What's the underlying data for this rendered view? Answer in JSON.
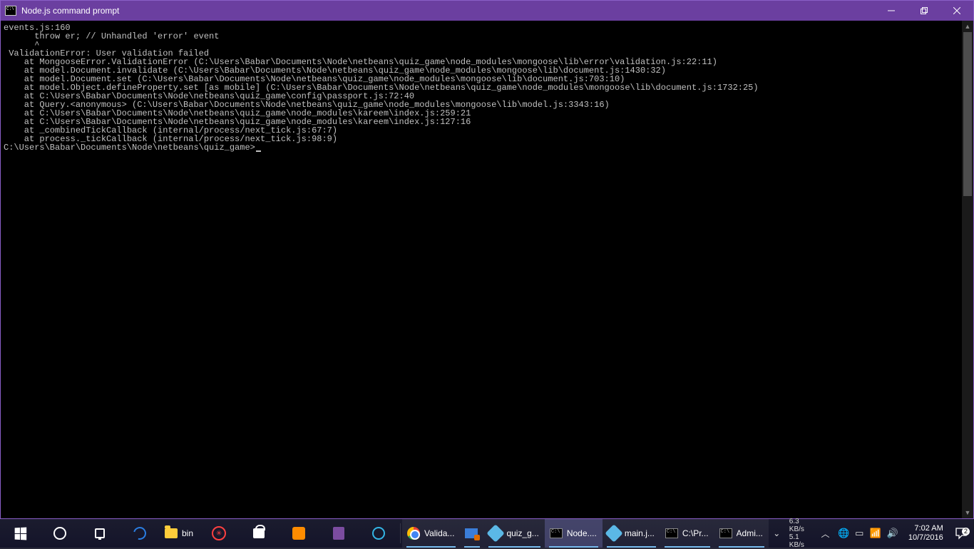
{
  "window": {
    "title": "Node.js command prompt",
    "lines": [
      "events.js:160",
      "      throw er; // Unhandled 'error' event",
      "      ^",
      " ValidationError: User validation failed",
      "    at MongooseError.ValidationError (C:\\Users\\Babar\\Documents\\Node\\netbeans\\quiz_game\\node_modules\\mongoose\\lib\\error\\validation.js:22:11)",
      "    at model.Document.invalidate (C:\\Users\\Babar\\Documents\\Node\\netbeans\\quiz_game\\node_modules\\mongoose\\lib\\document.js:1430:32)",
      "    at model.Document.set (C:\\Users\\Babar\\Documents\\Node\\netbeans\\quiz_game\\node_modules\\mongoose\\lib\\document.js:703:10)",
      "    at model.Object.defineProperty.set [as mobile] (C:\\Users\\Babar\\Documents\\Node\\netbeans\\quiz_game\\node_modules\\mongoose\\lib\\document.js:1732:25)",
      "    at C:\\Users\\Babar\\Documents\\Node\\netbeans\\quiz_game\\config\\passport.js:72:40",
      "    at Query.<anonymous> (C:\\Users\\Babar\\Documents\\Node\\netbeans\\quiz_game\\node_modules\\mongoose\\lib\\model.js:3343:16)",
      "    at C:\\Users\\Babar\\Documents\\Node\\netbeans\\quiz_game\\node_modules\\kareem\\index.js:259:21",
      "    at C:\\Users\\Babar\\Documents\\Node\\netbeans\\quiz_game\\node_modules\\kareem\\index.js:127:16",
      "    at _combinedTickCallback (internal/process/next_tick.js:67:7)",
      "    at process._tickCallback (internal/process/next_tick.js:98:9)",
      "",
      "C:\\Users\\Babar\\Documents\\Node\\netbeans\\quiz_game>"
    ],
    "prompt_has_cursor": true
  },
  "taskbar": {
    "pinned": [
      {
        "name": "start",
        "label": "",
        "icon": "win"
      },
      {
        "name": "cortana",
        "label": "",
        "icon": "circle"
      },
      {
        "name": "task-view",
        "label": "",
        "icon": "tv"
      },
      {
        "name": "edge",
        "label": "",
        "icon": "edge"
      },
      {
        "name": "explorer",
        "label": "bin",
        "icon": "folder"
      },
      {
        "name": "app-unknown",
        "label": "",
        "icon": "ringred"
      },
      {
        "name": "store",
        "label": "",
        "icon": "store"
      },
      {
        "name": "movies",
        "label": "",
        "icon": "media"
      },
      {
        "name": "onenote",
        "label": "",
        "icon": "note"
      },
      {
        "name": "cortana2",
        "label": "",
        "icon": "ccircle"
      }
    ],
    "running": [
      {
        "name": "chrome",
        "label": "Valida...",
        "icon": "chrome",
        "active": false
      },
      {
        "name": "snip",
        "label": "",
        "icon": "snip",
        "active": false
      },
      {
        "name": "netbeans",
        "label": "quiz_g...",
        "icon": "nb",
        "active": false
      },
      {
        "name": "nodecmd",
        "label": "Node....",
        "icon": "cmd",
        "active": true
      },
      {
        "name": "netbeans2",
        "label": "main.j...",
        "icon": "nb",
        "active": false
      },
      {
        "name": "cmd2",
        "label": "C:\\Pr...",
        "icon": "cmd",
        "active": false
      },
      {
        "name": "admin",
        "label": "Admi...",
        "icon": "cmd",
        "active": false
      }
    ],
    "net_up": "6.3 KB/s",
    "net_down": "5.1 KB/s",
    "clock_time": "7:02 AM",
    "clock_date": "10/7/2016",
    "action_center_badge": "2"
  }
}
